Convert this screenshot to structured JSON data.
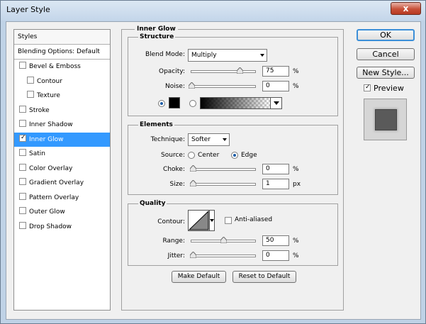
{
  "window": {
    "title": "Layer Style",
    "close_label": "x"
  },
  "styles_panel": {
    "header": "Styles",
    "blending_options": "Blending Options: Default",
    "items": [
      {
        "label": "Bevel & Emboss",
        "checked": false,
        "sub": false
      },
      {
        "label": "Contour",
        "checked": false,
        "sub": true
      },
      {
        "label": "Texture",
        "checked": false,
        "sub": true
      },
      {
        "label": "Stroke",
        "checked": false,
        "sub": false
      },
      {
        "label": "Inner Shadow",
        "checked": false,
        "sub": false
      },
      {
        "label": "Inner Glow",
        "checked": true,
        "sub": false,
        "selected": true
      },
      {
        "label": "Satin",
        "checked": false,
        "sub": false
      },
      {
        "label": "Color Overlay",
        "checked": false,
        "sub": false
      },
      {
        "label": "Gradient Overlay",
        "checked": false,
        "sub": false
      },
      {
        "label": "Pattern Overlay",
        "checked": false,
        "sub": false
      },
      {
        "label": "Outer Glow",
        "checked": false,
        "sub": false
      },
      {
        "label": "Drop Shadow",
        "checked": false,
        "sub": false
      }
    ],
    "checkmark": "✓"
  },
  "inner_glow": {
    "title": "Inner Glow",
    "structure": {
      "title": "Structure",
      "blend_mode_label": "Blend Mode:",
      "blend_mode_value": "Multiply",
      "opacity_label": "Opacity:",
      "opacity_value": "75",
      "opacity_unit": "%",
      "opacity_level": 0.75,
      "noise_label": "Noise:",
      "noise_value": "0",
      "noise_unit": "%",
      "noise_level": 0.0,
      "color": "#000000"
    },
    "elements": {
      "title": "Elements",
      "technique_label": "Technique:",
      "technique_value": "Softer",
      "source_label": "Source:",
      "source_center": "Center",
      "source_edge": "Edge",
      "choke_label": "Choke:",
      "choke_value": "0",
      "choke_unit": "%",
      "size_label": "Size:",
      "size_value": "1",
      "size_unit": "px"
    },
    "quality": {
      "title": "Quality",
      "contour_label": "Contour:",
      "anti_aliased_label": "Anti-aliased",
      "range_label": "Range:",
      "range_value": "50",
      "range_unit": "%",
      "range_level": 0.5,
      "jitter_label": "Jitter:",
      "jitter_value": "0",
      "jitter_unit": "%"
    },
    "make_default": "Make Default",
    "reset_default": "Reset to Default"
  },
  "actions": {
    "ok": "OK",
    "cancel": "Cancel",
    "new_style": "New Style...",
    "preview_label": "Preview"
  },
  "colors": {
    "selection": "#3399ff",
    "window_frame": "#bfd2e6",
    "preview_swatch": "#5a5a5a"
  }
}
